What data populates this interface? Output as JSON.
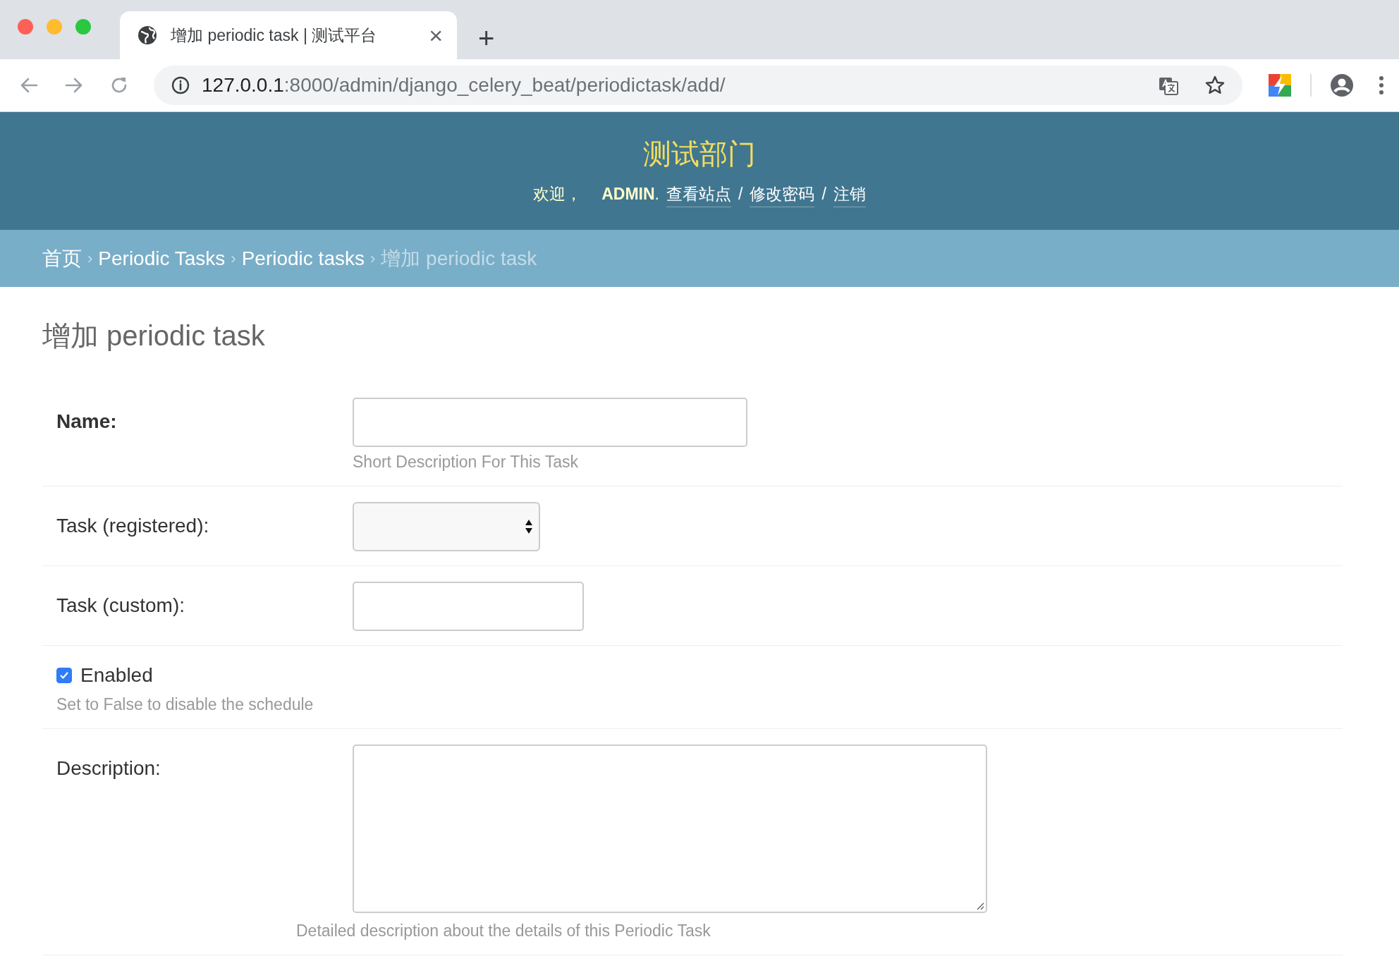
{
  "browser": {
    "tab": {
      "title": "增加 periodic task | 测试平台",
      "close": "×"
    },
    "new_tab": "+",
    "address": {
      "host": "127.0.0.1",
      "path": ":8000/admin/django_celery_beat/periodictask/add/"
    }
  },
  "header": {
    "site_name": "测试部门",
    "welcome": "欢迎，",
    "user": "ADMIN",
    "user_sep": ".",
    "links": [
      {
        "label": "查看站点"
      },
      {
        "label": "修改密码"
      },
      {
        "label": "注销"
      }
    ],
    "separator": "/"
  },
  "breadcrumbs": {
    "items": [
      {
        "label": "首页",
        "current": false
      },
      {
        "label": "Periodic Tasks",
        "current": false
      },
      {
        "label": "Periodic tasks",
        "current": false
      },
      {
        "label": "增加 periodic task",
        "current": true
      }
    ],
    "separator": "›"
  },
  "page_title": "增加 periodic task",
  "fields": [
    {
      "kind": "text",
      "label": "Name:",
      "required": true,
      "help": "Short Description For This Task"
    },
    {
      "kind": "select",
      "label": "Task (registered):",
      "required": false
    },
    {
      "kind": "text_short",
      "label": "Task (custom):",
      "required": false
    },
    {
      "kind": "checkbox",
      "label": "Enabled",
      "required": false,
      "checked": true,
      "help": "Set to False to disable the schedule"
    },
    {
      "kind": "textarea",
      "label": "Description:",
      "required": false,
      "help": "Detailed description about the details of this Periodic Task"
    }
  ]
}
